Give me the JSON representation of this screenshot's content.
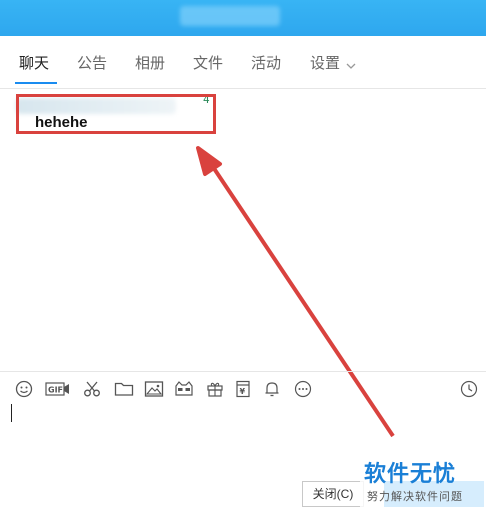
{
  "window": {
    "title_blurred": true
  },
  "tabs": [
    {
      "label": "聊天",
      "active": true
    },
    {
      "label": "公告"
    },
    {
      "label": "相册"
    },
    {
      "label": "文件"
    },
    {
      "label": "活动"
    },
    {
      "label": "设置"
    }
  ],
  "message": {
    "sender_blurred": true,
    "number": "4",
    "text": "hehehe"
  },
  "toolbar": {
    "icons": [
      "emoji-icon",
      "gif-icon",
      "scissors-icon",
      "folder-icon",
      "image-icon",
      "sticker-icon",
      "gift-icon",
      "red-packet-icon",
      "bell-icon",
      "more-icon",
      "history-clock-icon"
    ]
  },
  "buttons": {
    "close_label": "关闭(C)",
    "send_label": ""
  },
  "watermark": {
    "title": "软件无忧",
    "subtitle": "努力解决软件问题"
  },
  "colors": {
    "titlebar": "#2ea7ee",
    "accent": "#1a8cf0",
    "highlight": "#d9423e"
  }
}
